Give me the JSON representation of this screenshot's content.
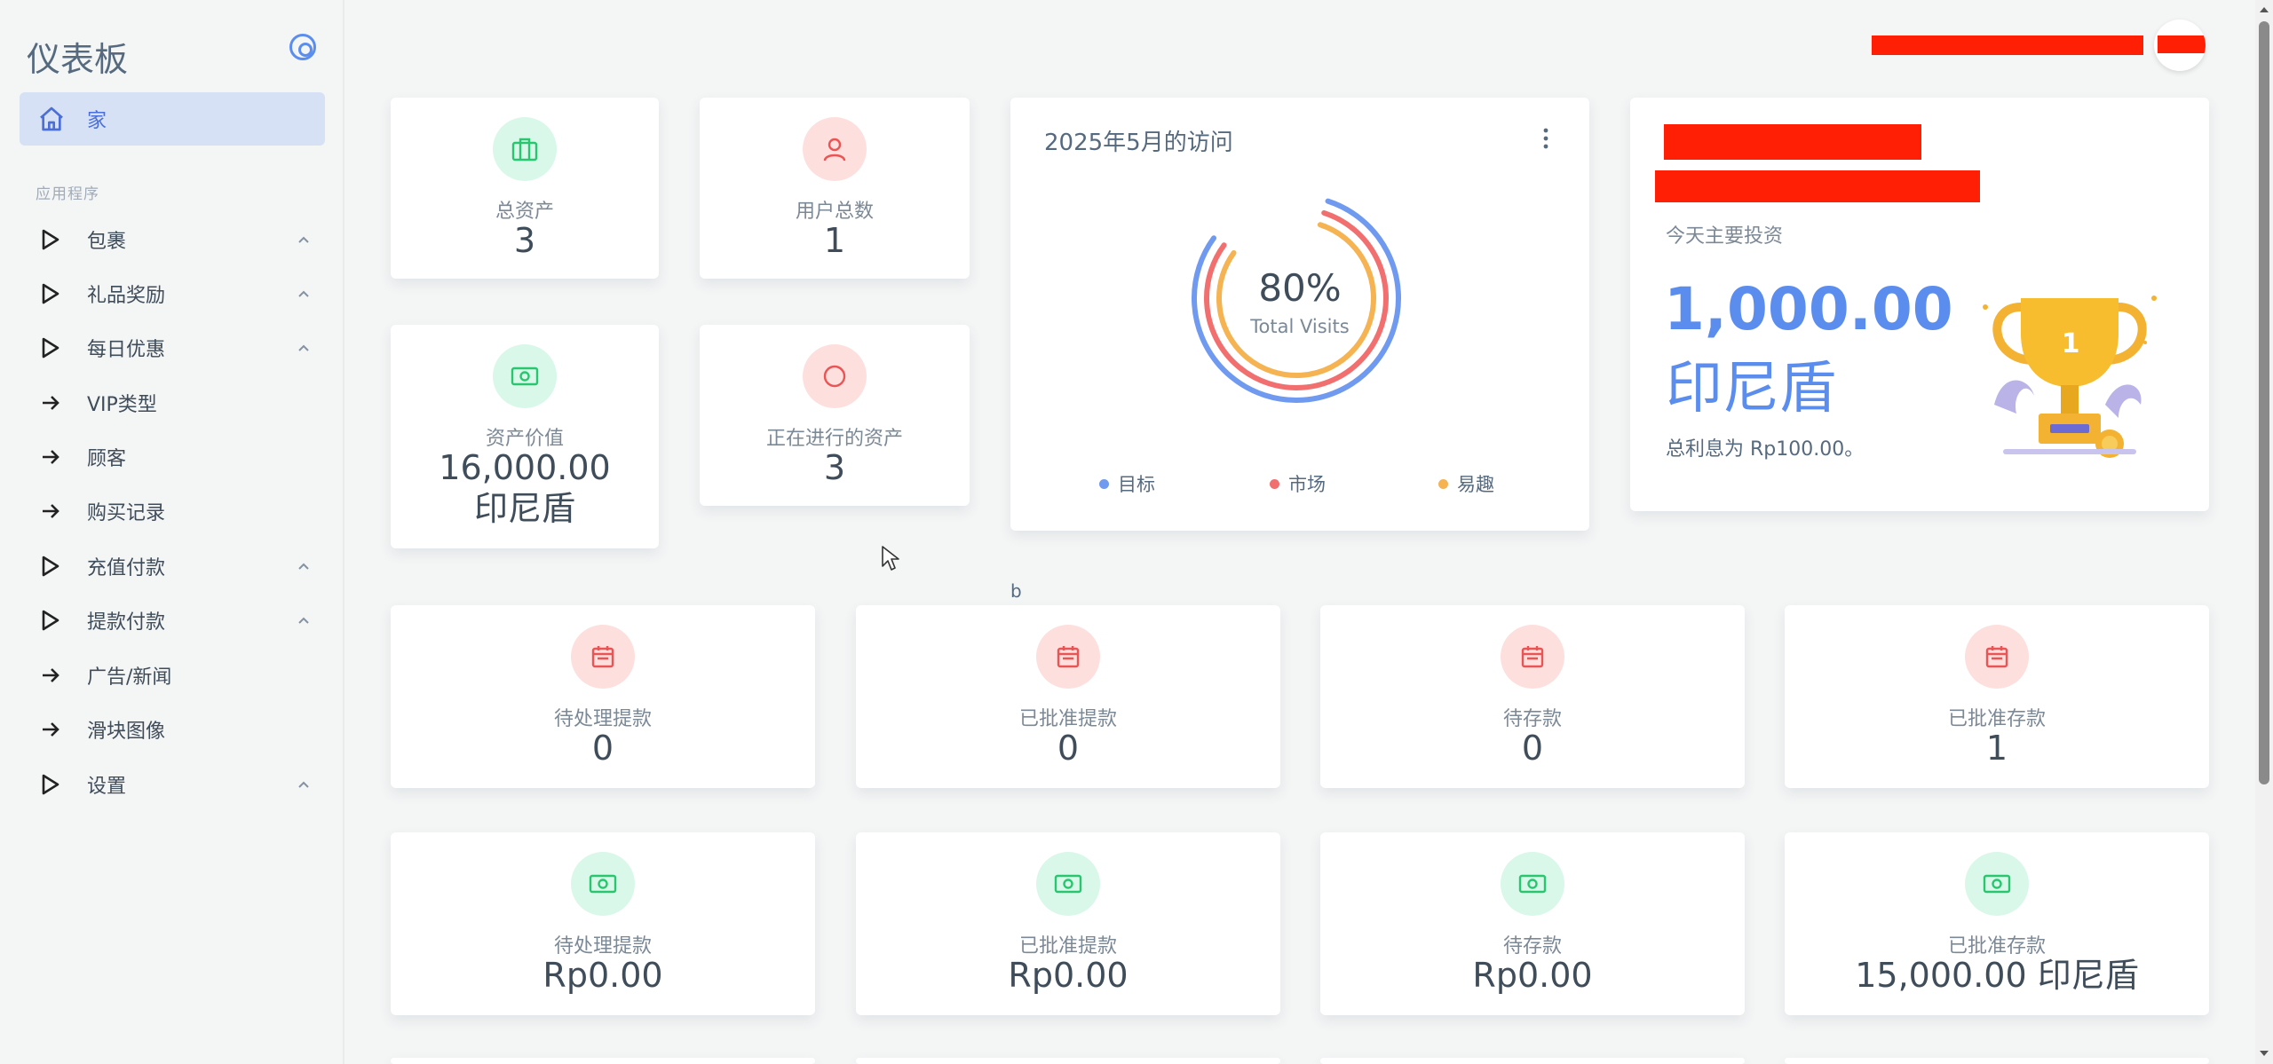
{
  "sidebar": {
    "brand": "仪表板",
    "home_label": "家",
    "section_label": "应用程序",
    "items": [
      {
        "label": "包裹",
        "icon": "play-outline-icon",
        "has_chevron": true
      },
      {
        "label": "礼品奖励",
        "icon": "play-outline-icon",
        "has_chevron": true
      },
      {
        "label": "每日优惠",
        "icon": "play-outline-icon",
        "has_chevron": true
      },
      {
        "label": "VIP类型",
        "icon": "arrow-right-icon",
        "has_chevron": false
      },
      {
        "label": "顾客",
        "icon": "arrow-right-icon",
        "has_chevron": false
      },
      {
        "label": "购买记录",
        "icon": "arrow-right-icon",
        "has_chevron": false
      },
      {
        "label": "充值付款",
        "icon": "play-outline-icon",
        "has_chevron": true
      },
      {
        "label": "提款付款",
        "icon": "play-outline-icon",
        "has_chevron": true
      },
      {
        "label": "广告/新闻",
        "icon": "arrow-right-icon",
        "has_chevron": false
      },
      {
        "label": "滑块图像",
        "icon": "arrow-right-icon",
        "has_chevron": false
      },
      {
        "label": "设置",
        "icon": "play-outline-icon",
        "has_chevron": true
      }
    ]
  },
  "stats_top": [
    {
      "title": "总资产",
      "value": "3",
      "icon": "briefcase-icon",
      "tone": "green"
    },
    {
      "title": "用户总数",
      "value": "1",
      "icon": "user-icon",
      "tone": "red"
    },
    {
      "title": "资产价值",
      "value": "16,000.00\n印尼盾",
      "icon": "cash-icon",
      "tone": "green"
    },
    {
      "title": "正在进行的资产",
      "value": "3",
      "icon": "circle-icon",
      "tone": "red"
    }
  ],
  "visits": {
    "title": "2025年5月的访问",
    "center_value": "80%",
    "center_label": "Total Visits",
    "legend": [
      {
        "label": "目标",
        "color": "#6f9af0"
      },
      {
        "label": "市场",
        "color": "#f26f6f"
      },
      {
        "label": "易趣",
        "color": "#f5b352"
      }
    ]
  },
  "investment": {
    "subtitle": "今天主要投资",
    "amount": "1,000.00",
    "currency": "印尼盾",
    "note": "总利息为 Rp100.00。",
    "trophy_number": "1"
  },
  "caption_b": "b",
  "stats_row2": [
    {
      "title": "待处理提款",
      "value": "0",
      "icon": "calendar-icon"
    },
    {
      "title": "已批准提款",
      "value": "0",
      "icon": "calendar-icon"
    },
    {
      "title": "待存款",
      "value": "0",
      "icon": "calendar-icon"
    },
    {
      "title": "已批准存款",
      "value": "1",
      "icon": "calendar-icon"
    }
  ],
  "stats_row3": [
    {
      "title": "待处理提款",
      "value": "Rp0.00",
      "icon": "cash-icon"
    },
    {
      "title": "已批准提款",
      "value": "Rp0.00",
      "icon": "cash-icon"
    },
    {
      "title": "待存款",
      "value": "Rp0.00",
      "icon": "cash-icon"
    },
    {
      "title": "已批准存款",
      "value": "15,000.00 印尼盾",
      "icon": "cash-icon"
    }
  ],
  "colors": {
    "accent": "#5b8def",
    "green": "#28c76f",
    "red": "#ea5455",
    "redaction": "#ff1f05"
  }
}
